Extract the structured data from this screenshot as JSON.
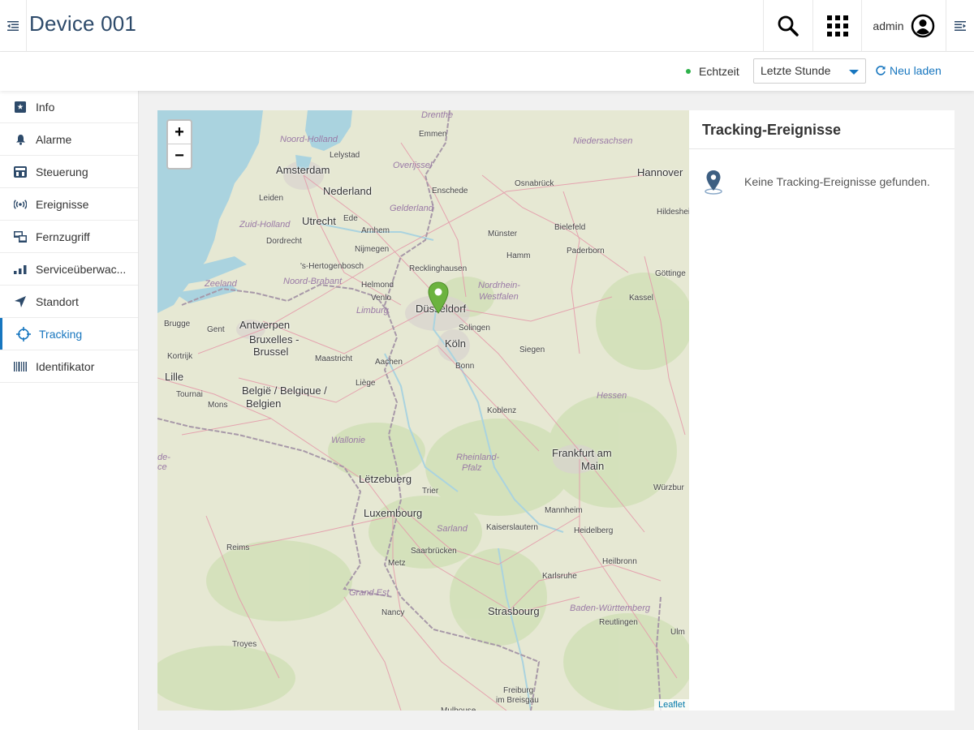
{
  "header": {
    "title": "Device 001",
    "user": "admin"
  },
  "actionbar": {
    "realtime_label": "Echtzeit",
    "time_range": "Letzte Stunde",
    "reload_label": "Neu laden"
  },
  "sidebar": {
    "items": [
      {
        "label": "Info",
        "icon": "info-icon"
      },
      {
        "label": "Alarme",
        "icon": "bell-icon"
      },
      {
        "label": "Steuerung",
        "icon": "control-icon"
      },
      {
        "label": "Ereignisse",
        "icon": "broadcast-icon"
      },
      {
        "label": "Fernzugriff",
        "icon": "remote-icon"
      },
      {
        "label": "Serviceüberwac...",
        "icon": "bar-chart-icon"
      },
      {
        "label": "Standort",
        "icon": "location-arrow-icon"
      },
      {
        "label": "Tracking",
        "icon": "crosshair-icon",
        "active": true
      },
      {
        "label": "Identifikator",
        "icon": "barcode-icon"
      }
    ]
  },
  "map": {
    "zoom_in": "+",
    "zoom_out": "−",
    "attribution": "Leaflet",
    "labels": [
      {
        "text": "Drenthe",
        "italic": true
      },
      {
        "text": "Emmen"
      },
      {
        "text": "Noord-Holland",
        "italic": true
      },
      {
        "text": "Lelystad"
      },
      {
        "text": "Overijssel",
        "italic": true
      },
      {
        "text": "Niedersachsen",
        "italic": true
      },
      {
        "text": "Amsterdam",
        "big": true
      },
      {
        "text": "Hannover",
        "big": true
      },
      {
        "text": "Nederland",
        "big": true
      },
      {
        "text": "Enschede"
      },
      {
        "text": "Osnabrück"
      },
      {
        "text": "Leiden"
      },
      {
        "text": "Utrecht",
        "big": true
      },
      {
        "text": "Gelderland",
        "italic": true
      },
      {
        "text": "Hildeshei"
      },
      {
        "text": "Zuid-Holland",
        "italic": true
      },
      {
        "text": "Ede"
      },
      {
        "text": "Bielefeld"
      },
      {
        "text": "Arnhem"
      },
      {
        "text": "Münster"
      },
      {
        "text": "Dordrecht"
      },
      {
        "text": "Nijmegen"
      },
      {
        "text": "Paderborn"
      },
      {
        "text": "Hamm"
      },
      {
        "text": "'s-Hertogenbosch"
      },
      {
        "text": "Recklinghausen"
      },
      {
        "text": "Göttinge"
      },
      {
        "text": "Zeeland",
        "italic": true
      },
      {
        "text": "Noord-Brabant",
        "italic": true
      },
      {
        "text": "Helmond"
      },
      {
        "text": "Nordrhein-",
        "italic": true
      },
      {
        "text": "Westfalen",
        "italic": true
      },
      {
        "text": "Kassel"
      },
      {
        "text": "Düsseldorf",
        "big": true
      },
      {
        "text": "Venlo"
      },
      {
        "text": "Limburg",
        "italic": true
      },
      {
        "text": "Antwerpen",
        "big": true
      },
      {
        "text": "Brugge"
      },
      {
        "text": "Gent"
      },
      {
        "text": "Solingen"
      },
      {
        "text": "Bruxelles -",
        "big": true
      },
      {
        "text": "Brussel",
        "big": true
      },
      {
        "text": "Köln",
        "big": true
      },
      {
        "text": "Kortrijk"
      },
      {
        "text": "Maastricht"
      },
      {
        "text": "Aachen"
      },
      {
        "text": "Siegen"
      },
      {
        "text": "Lille",
        "big": true
      },
      {
        "text": "Bonn"
      },
      {
        "text": "Liège"
      },
      {
        "text": "Tournai"
      },
      {
        "text": "België / Belgique /",
        "big": true
      },
      {
        "text": "Belgien",
        "big": true
      },
      {
        "text": "Hessen",
        "italic": true
      },
      {
        "text": "Mons"
      },
      {
        "text": "Koblenz"
      },
      {
        "text": "Wallonie",
        "italic": true
      },
      {
        "text": "Rheinland-",
        "italic": true
      },
      {
        "text": "Pfalz",
        "italic": true
      },
      {
        "text": "Frankfurt am",
        "big": true
      },
      {
        "text": "Main",
        "big": true
      },
      {
        "text": "de-",
        "italic": true
      },
      {
        "text": "ce",
        "italic": true
      },
      {
        "text": "Lëtzebuerg",
        "big": true
      },
      {
        "text": "Trier"
      },
      {
        "text": "Würzbur"
      },
      {
        "text": "Luxembourg",
        "big": true
      },
      {
        "text": "Mannheim"
      },
      {
        "text": "Sarland",
        "italic": true
      },
      {
        "text": "Kaiserslautern"
      },
      {
        "text": "Heidelberg"
      },
      {
        "text": "Reims"
      },
      {
        "text": "Saarbrücken"
      },
      {
        "text": "Heilbronn"
      },
      {
        "text": "Metz"
      },
      {
        "text": "Karlsruhe"
      },
      {
        "text": "Grand Est",
        "italic": true
      },
      {
        "text": "Baden-Württemberg",
        "italic": true
      },
      {
        "text": "Nancy"
      },
      {
        "text": "Strasbourg",
        "big": true
      },
      {
        "text": "Reutlingen"
      },
      {
        "text": "Ulm"
      },
      {
        "text": "Troyes"
      },
      {
        "text": "Freiburg"
      },
      {
        "text": "im Breisgau"
      },
      {
        "text": "Mulhouse"
      }
    ]
  },
  "panel": {
    "title": "Tracking-Ereignisse",
    "empty_message": "Keine Tracking-Ereignisse gefunden."
  },
  "colors": {
    "accent": "#1776bf",
    "marker": "#6cb33f",
    "title": "#2d4a6a",
    "online": "#2db14a"
  }
}
